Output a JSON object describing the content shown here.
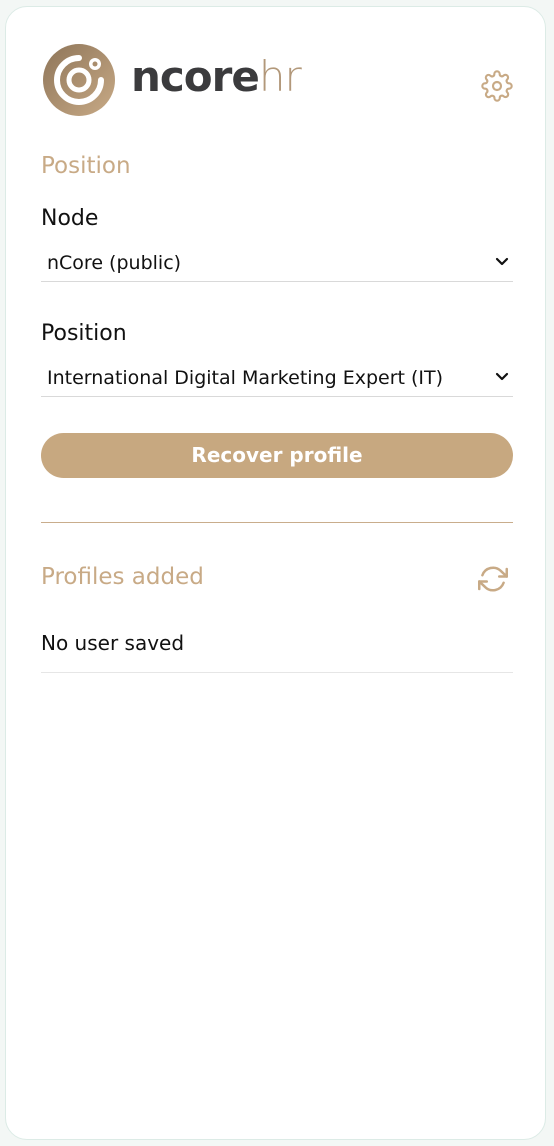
{
  "header": {
    "logo_part1": "ncore",
    "logo_part2": "hr",
    "settings_icon": "gear-icon"
  },
  "position_section": {
    "title": "Position",
    "node_label": "Node",
    "node_value": "nCore (public)",
    "position_label": "Position",
    "position_value": "International Digital Marketing Expert (IT)",
    "recover_button": "Recover profile"
  },
  "profiles_section": {
    "title": "Profiles added",
    "refresh_icon": "refresh-icon",
    "empty_text": "No user saved"
  },
  "colors": {
    "accent": "#c7a880",
    "logo_dark": "#3b3b3d"
  }
}
